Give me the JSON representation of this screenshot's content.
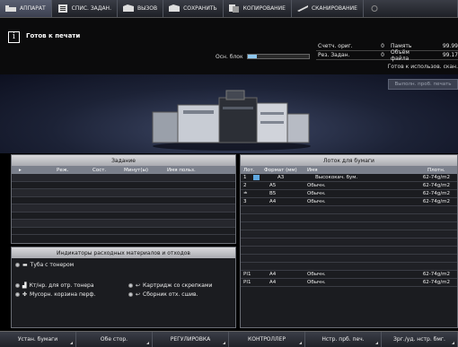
{
  "tabs": [
    {
      "label": "АППАРАТ",
      "icon": "machine-icon",
      "active": true
    },
    {
      "label": "СПИС. ЗАДАН.",
      "icon": "job-list-icon"
    },
    {
      "label": "ВЫЗОВ",
      "icon": "recall-icon"
    },
    {
      "label": "СОХРАНИТЬ",
      "icon": "save-icon"
    },
    {
      "label": "КОПИРОВАНИЕ",
      "icon": "copy-icon"
    },
    {
      "label": "СКАНИРОВАНИЕ",
      "icon": "scan-icon"
    }
  ],
  "status": {
    "message": "Готов к печати",
    "osn_block_label": "Осн. блок",
    "osn_block_level": 0.15,
    "counters": [
      {
        "label": "Счетч. ориг.",
        "value": "0",
        "label2": "Память",
        "value2": "99.99"
      },
      {
        "label": "Рез. Задан.",
        "value": "0",
        "label2": "Объём файла",
        "value2": "99.17"
      }
    ],
    "ready_for_use": "Готов к использов. скан."
  },
  "banner": {
    "exec_button": "Выполн. проб. печать"
  },
  "job_panel": {
    "title": "Задание",
    "columns": [
      "Реж.",
      "Сост.",
      "Минут(ы)",
      "Имя польз."
    ],
    "row_count": 8
  },
  "consumables": {
    "title": "Индикаторы расходных материалов и отходов",
    "items": [
      {
        "label": "Туба с тонером",
        "icon": "toner-tube-icon"
      },
      {
        "label": "Кт/нр. для отр. тонера",
        "icon": "waste-toner-icon"
      },
      {
        "label": "Мусорн. корзина перф.",
        "icon": "punch-waste-icon"
      },
      {
        "label": "Картридж со скрепками",
        "icon": "staple-cartridge-icon"
      },
      {
        "label": "Сборник отх. сшив.",
        "icon": "staple-waste-icon"
      }
    ]
  },
  "tray_panel": {
    "title": "Лоток для бумаги",
    "columns": [
      "Лот.",
      "Формат (мм)",
      "Имя",
      "Плотн."
    ],
    "rows": [
      {
        "lot": "1",
        "format": "A3",
        "name": "Высококач. бум.",
        "density": "62-74g/m2",
        "selected": true
      },
      {
        "lot": "2",
        "format": "A5",
        "name": "Обычн.",
        "density": "62-74g/m2"
      },
      {
        "lot": "≐",
        "format": "B5",
        "name": "Обычн.",
        "density": "62-74g/m2"
      },
      {
        "lot": "3",
        "format": "A4",
        "name": "Обычн.",
        "density": "62-74g/m2"
      }
    ],
    "pi_rows": [
      {
        "lot": "PI1",
        "format": "A4",
        "name": "Обычн.",
        "density": "62-74g/m2"
      },
      {
        "lot": "PI1",
        "format": "A4",
        "name": "Обычн.",
        "density": "62-74g/m2"
      }
    ]
  },
  "bottom": [
    "Устан. бумаги",
    "Обе стор.",
    "РЕГУЛИРОВКА",
    "КОНТРОЛЛЕР",
    "Нстр. прб. печ.",
    "Зрг./уд. нстр. бмг."
  ]
}
